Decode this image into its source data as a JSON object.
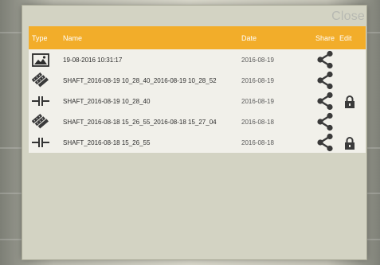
{
  "dialog": {
    "close_label": "Close"
  },
  "table": {
    "headers": {
      "type": "Type",
      "name": "Name",
      "date": "Date",
      "share": "Share",
      "edit": "Edit"
    },
    "rows": [
      {
        "type_icon": "image-icon",
        "name": "19-08-2016 10:31:17",
        "date": "2016-08-19",
        "locked": false
      },
      {
        "type_icon": "stack-icon",
        "name": "SHAFT_2016-08-19 10_28_40_2016-08-19 10_28_52",
        "date": "2016-08-19",
        "locked": false
      },
      {
        "type_icon": "shaft-icon",
        "name": "SHAFT_2016-08-19 10_28_40",
        "date": "2016-08-19",
        "locked": true
      },
      {
        "type_icon": "stack-icon",
        "name": "SHAFT_2016-08-18 15_26_55_2016-08-18 15_27_04",
        "date": "2016-08-18",
        "locked": false
      },
      {
        "type_icon": "shaft-icon",
        "name": "SHAFT_2016-08-18 15_26_55",
        "date": "2016-08-18",
        "locked": true
      }
    ]
  },
  "colors": {
    "header": "#f2ad2a",
    "panel": "#d3d3c3",
    "rows": "#f1f0ea"
  }
}
